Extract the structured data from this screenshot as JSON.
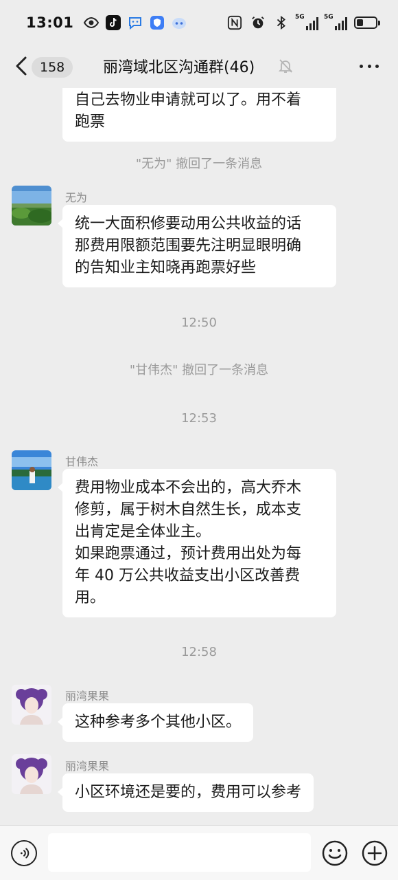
{
  "status_bar": {
    "time": "13:01",
    "signal_label_1": "5G",
    "signal_label_2": "5G"
  },
  "header": {
    "unread_count": "158",
    "title": "丽湾域北区沟通群(46)"
  },
  "messages": {
    "m1": {
      "lines": [
        "自己去物业申请就可以了。用不着",
        "跑票"
      ]
    },
    "s1": "\"无为\" 撤回了一条消息",
    "m2": {
      "sender": "无为",
      "lines": [
        "统一大面积修要动用公共收益的话",
        "那费用限额范围要先注明显眼明确",
        "的告知业主知晓再跑票好些"
      ]
    },
    "t1": "12:50",
    "s2": "\"甘伟杰\" 撤回了一条消息",
    "t2": "12:53",
    "m3": {
      "sender": "甘伟杰",
      "lines": [
        "费用物业成本不会出的，高大乔木",
        "修剪，属于树木自然生长，成本支",
        "出肯定是全体业主。",
        "如果跑票通过，预计费用出处为每",
        "年 40 万公共收益支出小区改善费",
        "用。"
      ]
    },
    "t3": "12:58",
    "m4": {
      "sender": "丽湾果果",
      "lines": [
        "这种参考多个其他小区。"
      ]
    },
    "m5": {
      "sender": "丽湾果果",
      "lines": [
        "小区环境还是要的，费用可以参考"
      ]
    }
  }
}
